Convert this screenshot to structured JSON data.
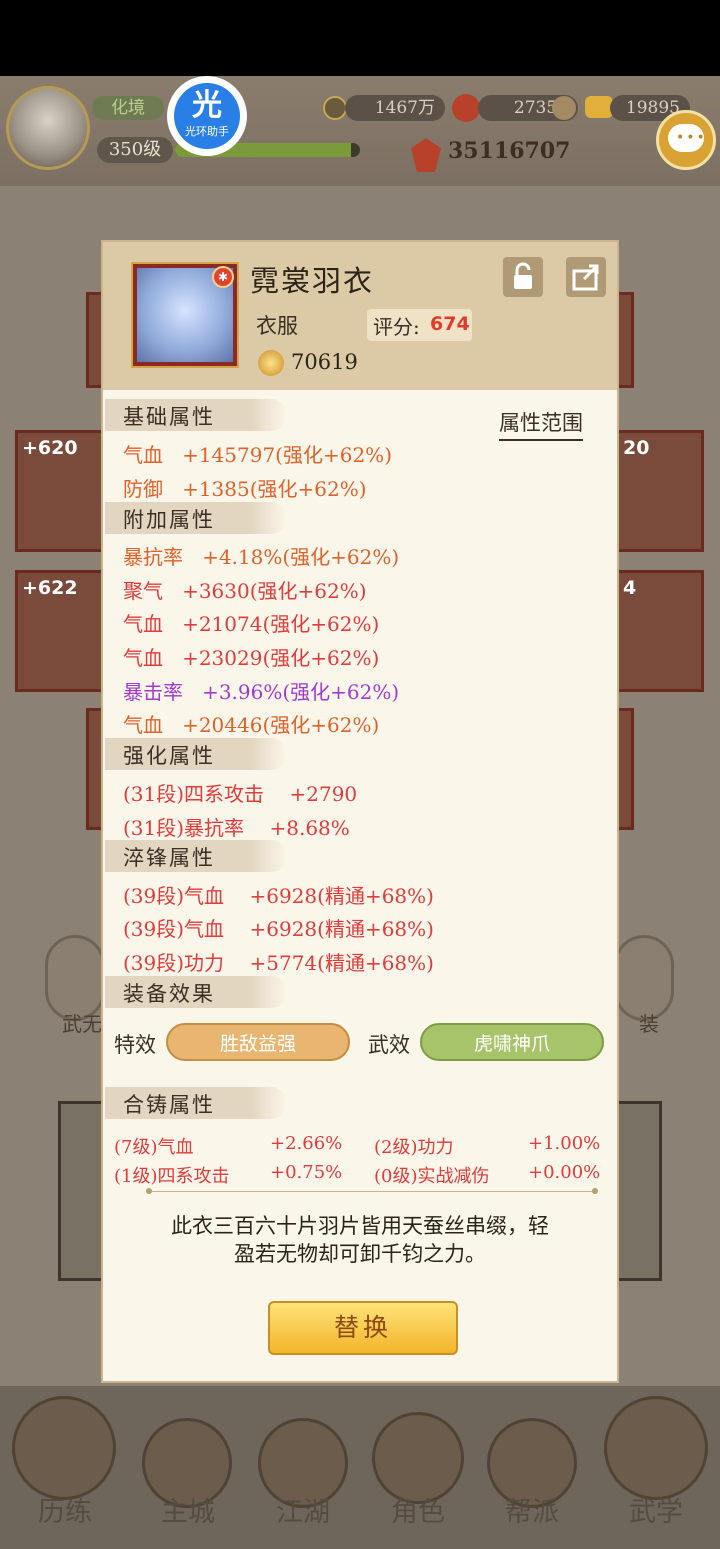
{
  "hud": {
    "realm": "化境",
    "level": "350级",
    "exp_fraction": 0.95,
    "badge_char": "光",
    "badge_label": "光环助手",
    "currency1": "1467万",
    "currency2": "27355",
    "currency3": "19895",
    "power": "35116707"
  },
  "background": {
    "slot_labels": [
      "+620",
      "20",
      "+622",
      "4"
    ]
  },
  "item": {
    "name": "霓裳羽衣",
    "type": "衣服",
    "score_label": "评分:",
    "score": "674",
    "gem_value": "70619",
    "range_link": "属性范围"
  },
  "sections": {
    "base": {
      "title": "基础属性",
      "lines": [
        "气血   +145797(强化+62%)",
        "防御   +1385(强化+62%)"
      ]
    },
    "extra": {
      "title": "附加属性",
      "lines": [
        {
          "text": "暴抗率   +4.18%(强化+62%)",
          "color": "orange"
        },
        {
          "text": "聚气   +3630(强化+62%)",
          "color": "red"
        },
        {
          "text": "气血   +21074(强化+62%)",
          "color": "red"
        },
        {
          "text": "气血   +23029(强化+62%)",
          "color": "red"
        },
        {
          "text": "暴击率   +3.96%(强化+62%)",
          "color": "purple"
        },
        {
          "text": "气血   +20446(强化+62%)",
          "color": "orange"
        }
      ]
    },
    "enhance": {
      "title": "强化属性",
      "lines": [
        "(31段)四系攻击    +2790",
        "(31段)暴抗率    +8.68%"
      ]
    },
    "temper": {
      "title": "淬锋属性",
      "lines": [
        "(39段)气血    +6928(精通+68%)",
        "(39段)气血    +6928(精通+68%)",
        "(39段)功力    +5774(精通+68%)"
      ]
    },
    "effects": {
      "title": "装备效果",
      "special_label": "特效",
      "special_value": "胜敌益强",
      "martial_label": "武效",
      "martial_value": "虎啸神爪"
    },
    "alloy": {
      "title": "合铸属性",
      "rows": [
        {
          "left_name": "(7级)气血",
          "left_val": "+2.66%",
          "right_name": "(2级)功力",
          "right_val": "+1.00%"
        },
        {
          "left_name": "(1级)四系攻击",
          "left_val": "+0.75%",
          "right_name": "(0级)实战减伤",
          "right_val": "+0.00%"
        }
      ]
    }
  },
  "description_line1": "此衣三百六十片羽片皆用天蚕丝串缀，轻",
  "description_line2": "盈若无物却可卸千钧之力。",
  "replace_button": "替换",
  "bottom_nav": [
    "历练",
    "主城",
    "江湖",
    "角色",
    "帮派",
    "武学"
  ],
  "side_buttons": [
    "武无",
    "装"
  ]
}
